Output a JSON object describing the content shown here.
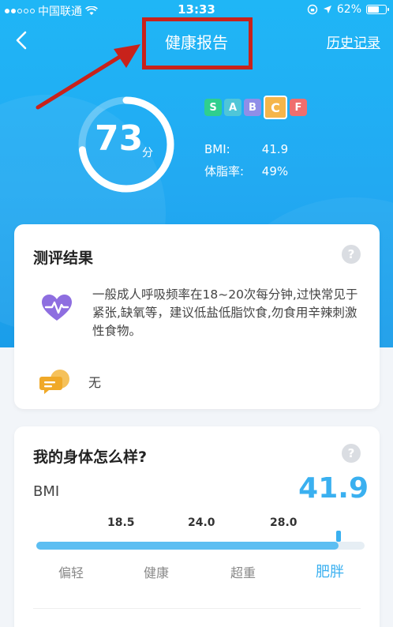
{
  "status_bar": {
    "carrier": "中国联通",
    "time": "13:33",
    "battery": "62%"
  },
  "nav": {
    "title": "健康报告",
    "history_link": "历史记录"
  },
  "score": {
    "value": "73",
    "unit": "分",
    "fraction": 0.73
  },
  "grades": [
    {
      "label": "S",
      "color": "#2fcf8e",
      "active": false
    },
    {
      "label": "A",
      "color": "#4fc6d8",
      "active": false
    },
    {
      "label": "B",
      "color": "#8f8ee8",
      "active": false
    },
    {
      "label": "C",
      "color": "#f5b54a",
      "active": true
    },
    {
      "label": "F",
      "color": "#ef6e6e",
      "active": false
    }
  ],
  "metrics": {
    "bmi_label": "BMI:",
    "bmi_value": "41.9",
    "bodyfat_label": "体脂率:",
    "bodyfat_value": "49%"
  },
  "result_card": {
    "title": "测评结果",
    "help": "?",
    "text": "一般成人呼吸频率在18~20次每分钟,过快常见于紧张,缺氧等，建议低盐低脂饮食,勿食用辛辣刺激性食物。",
    "none_text": "无"
  },
  "body_card": {
    "title": "我的身体怎么样?",
    "help": "?",
    "bmi_label": "BMI",
    "bmi_value": "41.9",
    "thresholds": [
      "18.5",
      "24.0",
      "28.0"
    ],
    "categories": [
      "偏轻",
      "健康",
      "超重",
      "肥胖"
    ],
    "active_category": 3,
    "bar_fill_fraction": 0.92
  },
  "colors": {
    "accent": "#3ab0f0",
    "hero": "#1fb6f6",
    "annotation": "#c8221b"
  }
}
